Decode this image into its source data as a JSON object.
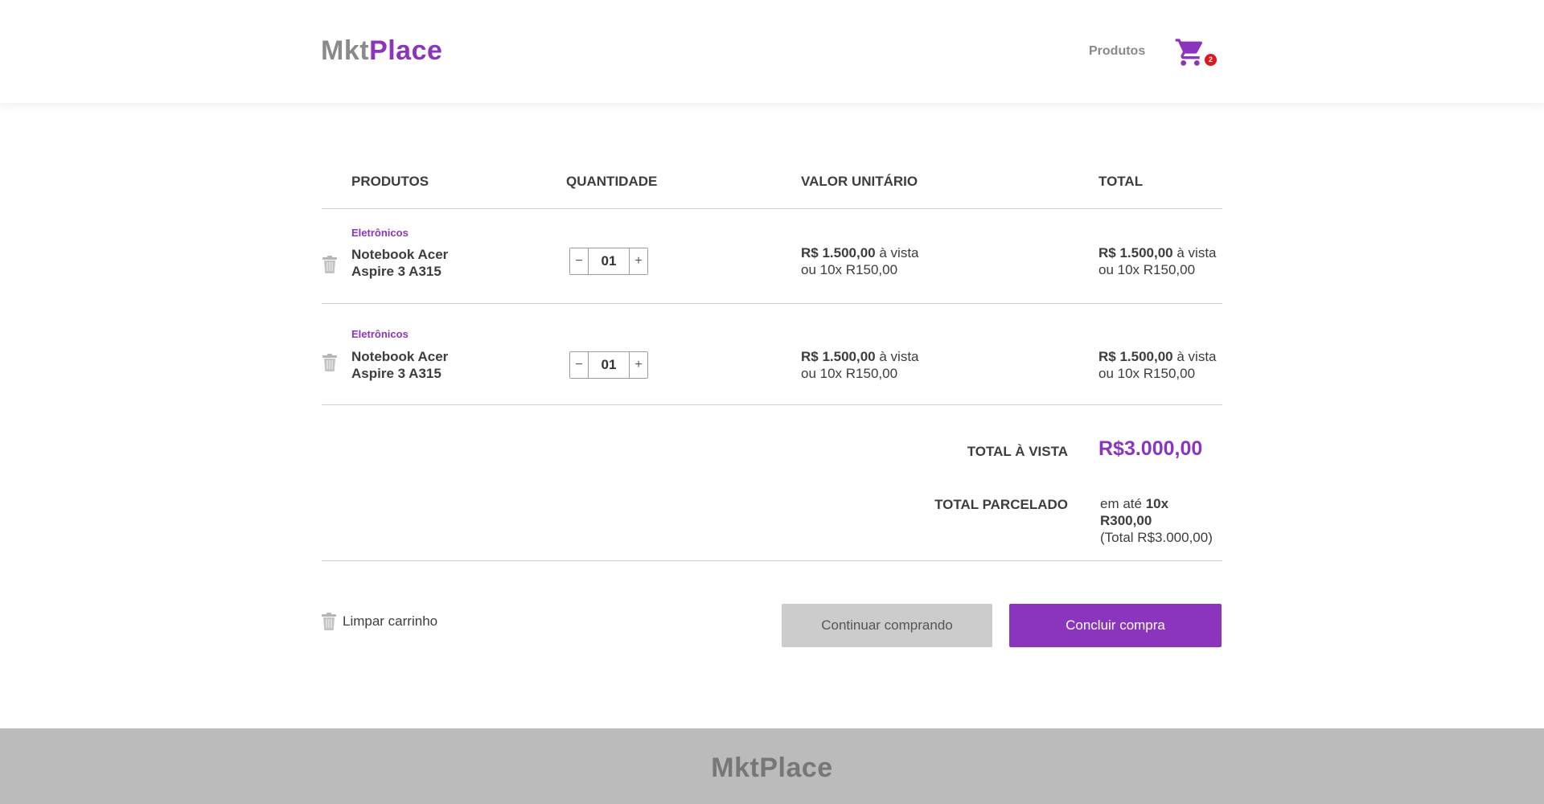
{
  "brand": {
    "part1": "Mkt",
    "part2": "Place"
  },
  "nav": {
    "produtos": "Produtos",
    "cart_count": "2"
  },
  "table": {
    "headers": {
      "produtos": "PRODUTOS",
      "quantidade": "QUANTIDADE",
      "valor_unitario": "VALOR UNITÁRIO",
      "total": "TOTAL"
    },
    "rows": [
      {
        "category": "Eletrônicos",
        "name_line1": "Notebook Acer",
        "name_line2": "Aspire 3 A315",
        "quantity": "01",
        "unit_price": "R$ 1.500,00",
        "unit_suffix": " à vista",
        "unit_installments": "ou 10x R150,00",
        "total_price": "R$ 1.500,00",
        "total_suffix": " à vista",
        "total_installments": "ou 10x R150,00"
      },
      {
        "category": "Eletrônicos",
        "name_line1": "Notebook Acer",
        "name_line2": "Aspire 3 A315",
        "quantity": "01",
        "unit_price": "R$ 1.500,00",
        "unit_suffix": " à vista",
        "unit_installments": "ou 10x R150,00",
        "total_price": "R$ 1.500,00",
        "total_suffix": " à vista",
        "total_installments": "ou 10x R150,00"
      }
    ]
  },
  "summary": {
    "total_vista_label": "TOTAL À VISTA",
    "total_vista_value": "R$3.000,00",
    "total_parcelado_label": "TOTAL PARCELADO",
    "parcelado_prefix": "em até ",
    "parcelado_value": "10x R300,00",
    "parcelado_total": "(Total R$3.000,00)"
  },
  "actions": {
    "clear_cart": "Limpar carrinho",
    "continue": "Continuar comprando",
    "finish": "Concluir compra"
  },
  "qty_buttons": {
    "minus": "−",
    "plus": "+"
  },
  "colors": {
    "accent": "#8b35bf",
    "badge": "#e0161f",
    "footer": "#bbbbbb"
  },
  "icons": {
    "cart": "shopping-cart-icon",
    "trash": "trash-icon"
  }
}
